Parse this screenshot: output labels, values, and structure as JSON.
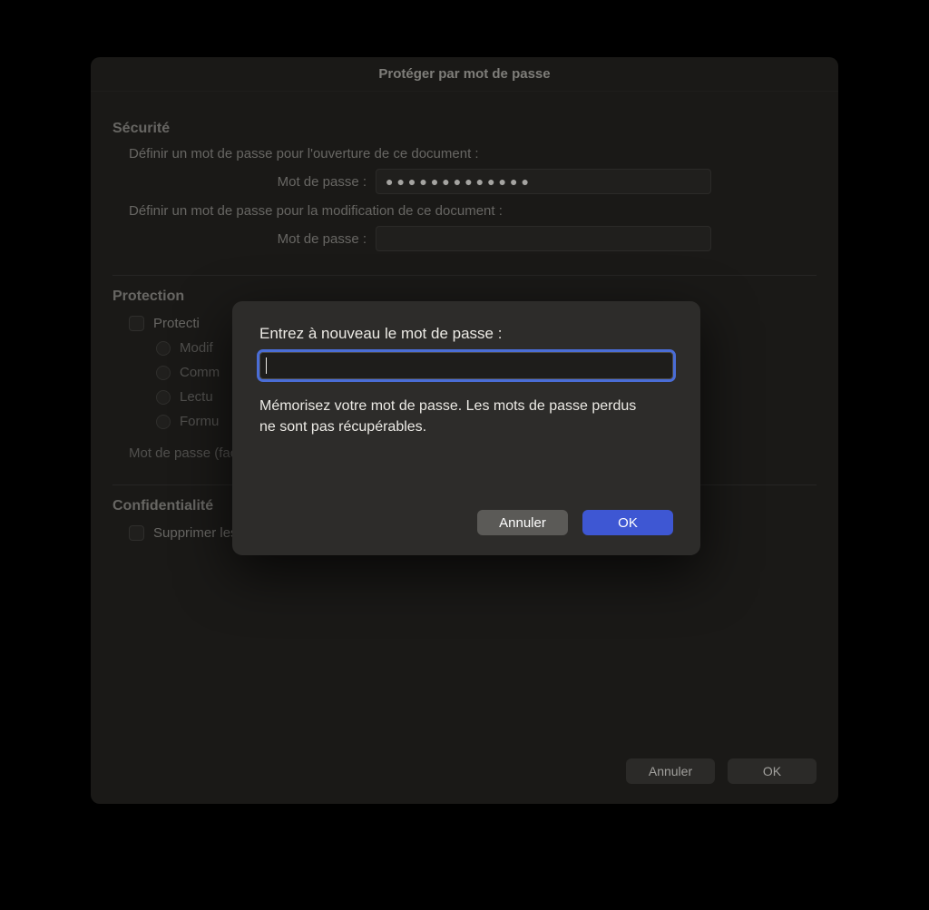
{
  "window": {
    "title": "Protéger par mot de passe",
    "security": {
      "heading": "Sécurité",
      "open_prompt": "Définir un mot de passe pour l'ouverture de ce document :",
      "modify_prompt": "Définir un mot de passe pour la modification de ce document :",
      "password_label": "Mot de passe :",
      "open_password_mask": "●●●●●●●●●●●●●"
    },
    "protection": {
      "heading": "Protection",
      "checkbox_label": "Protecti",
      "radios": {
        "modify": "Modif",
        "comment": "Comm",
        "read": "Lectu",
        "form": "Formu"
      },
      "optional_label": "Mot de passe (facultatif) :"
    },
    "confidentiality": {
      "heading": "Confidentialité",
      "checkbox_label": "Supprimer les informations personnelles du fichier lors de l'enregistrement"
    },
    "footer": {
      "cancel": "Annuler",
      "ok": "OK"
    }
  },
  "modal": {
    "prompt": "Entrez à nouveau le mot de passe :",
    "hint": "Mémorisez votre mot de passe. Les mots de passe perdus ne sont pas récupérables.",
    "cancel": "Annuler",
    "ok": "OK"
  }
}
